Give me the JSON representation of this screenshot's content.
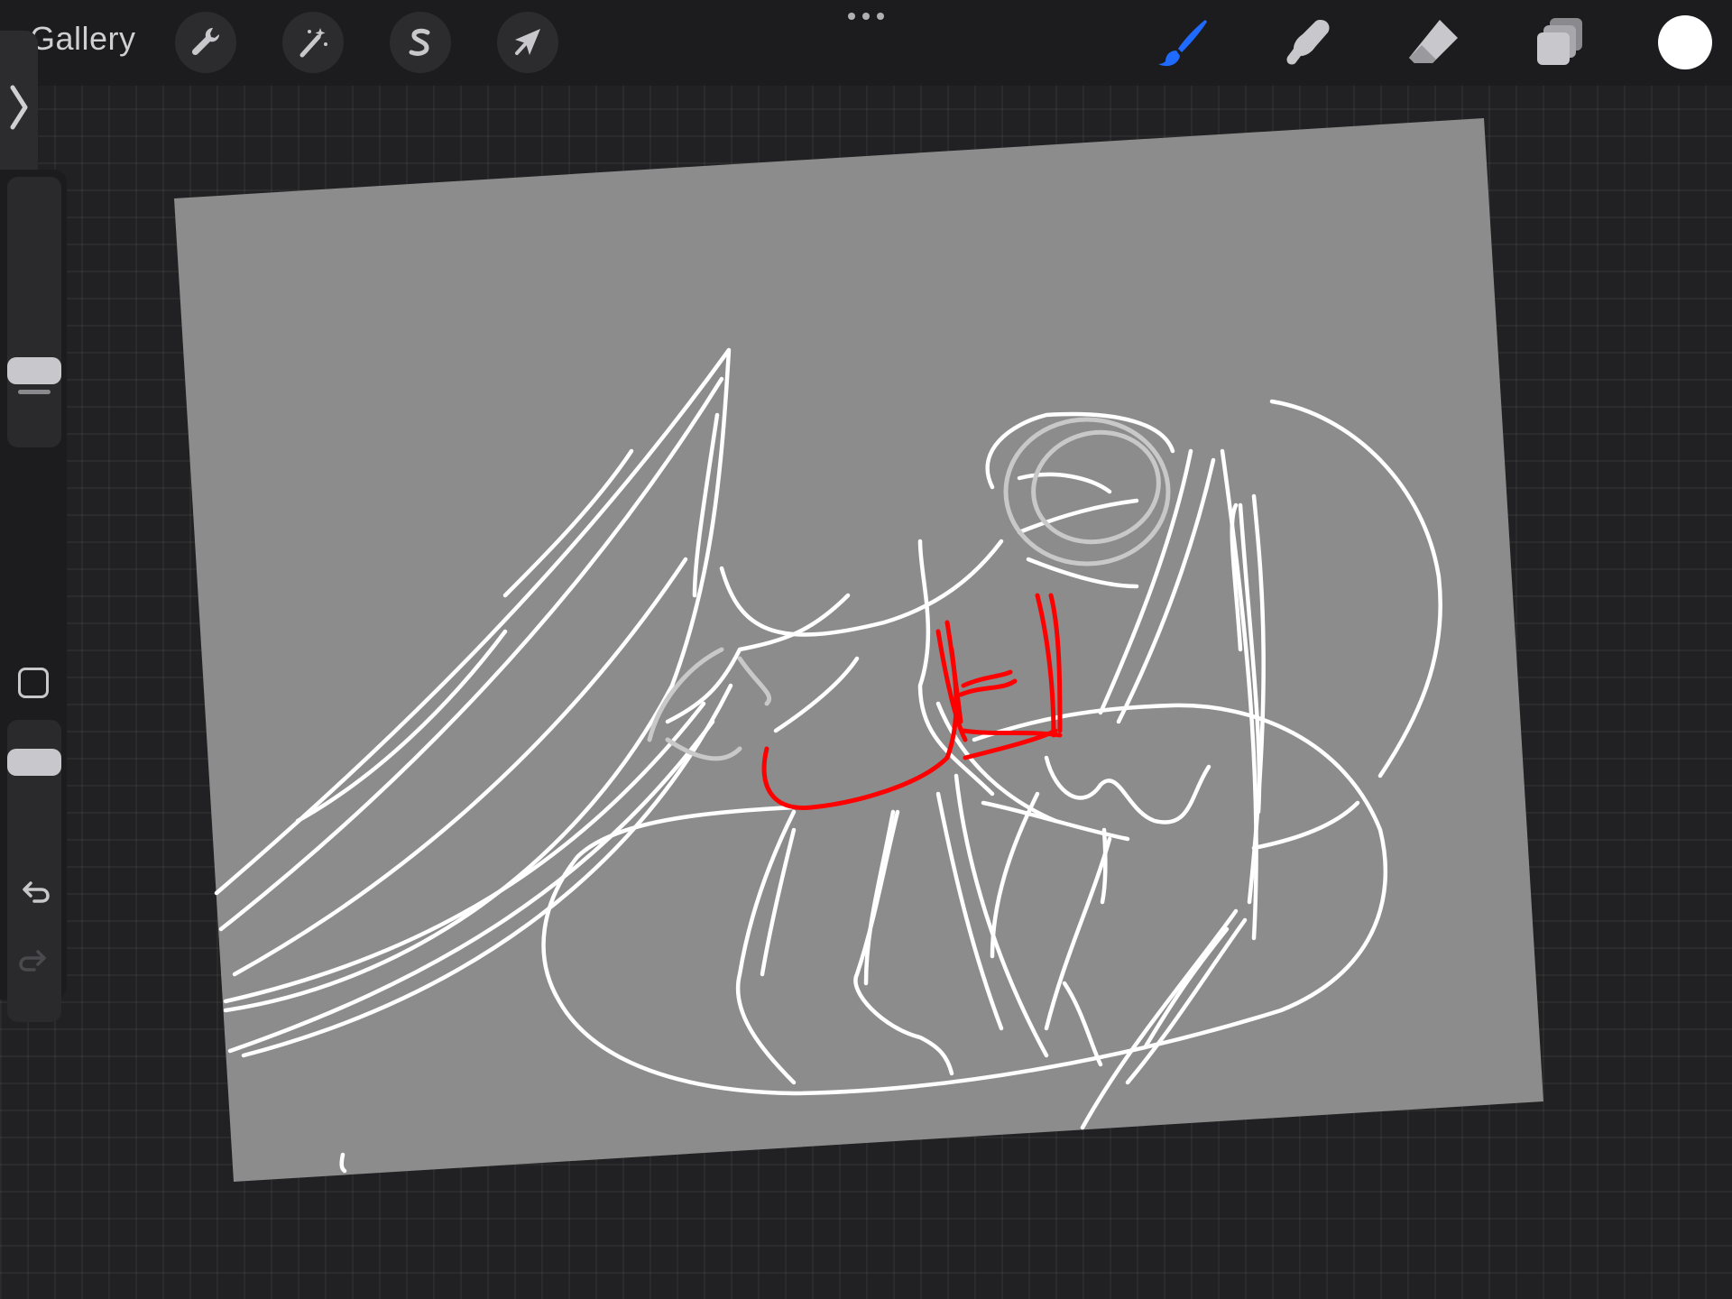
{
  "app": {
    "gallery_label": "Gallery"
  },
  "toolbar": {
    "left_tools": [
      {
        "name": "actions",
        "icon": "wrench-icon"
      },
      {
        "name": "adjustments",
        "icon": "magic-wand-icon"
      },
      {
        "name": "selection",
        "icon": "selection-s-icon"
      },
      {
        "name": "transform",
        "icon": "arrow-cursor-icon"
      }
    ],
    "right_tools": [
      {
        "name": "brush",
        "icon": "brush-icon",
        "active": true
      },
      {
        "name": "smudge",
        "icon": "smudge-finger-icon"
      },
      {
        "name": "eraser",
        "icon": "eraser-icon"
      },
      {
        "name": "layers",
        "icon": "layers-icon"
      }
    ],
    "active_color": "#ffffff",
    "accent_color": "#1f6bff"
  },
  "sidebar": {
    "brush_size_level": 0.73,
    "brush_opacity_level": 0.63
  },
  "canvas": {
    "background": "#8c8c8c",
    "stroke_color": "#ffffff",
    "accent_stroke_color": "#ff0000"
  }
}
